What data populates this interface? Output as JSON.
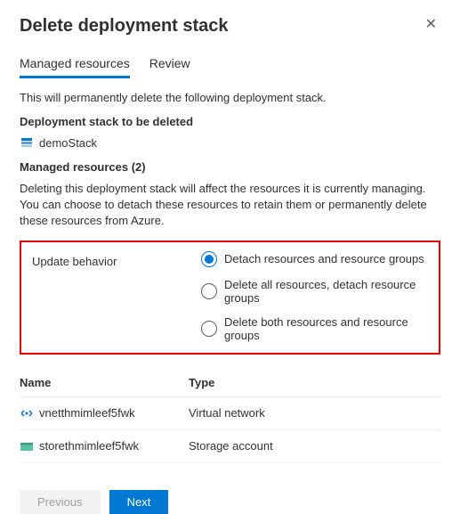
{
  "title": "Delete deployment stack",
  "tabs": {
    "managed": "Managed resources",
    "review": "Review"
  },
  "intro": "This will permanently delete the following deployment stack.",
  "stack_heading": "Deployment stack to be deleted",
  "stack_name": "demoStack",
  "managed_heading": "Managed resources (2)",
  "managed_warning": "Deleting this deployment stack will affect the resources it is currently managing. You can choose to detach these resources to retain them or permanently delete these resources from Azure.",
  "behavior": {
    "label": "Update behavior",
    "options": [
      {
        "label": "Detach resources and resource groups",
        "selected": true
      },
      {
        "label": "Delete all resources, detach resource groups",
        "selected": false
      },
      {
        "label": "Delete both resources and resource groups",
        "selected": false
      }
    ]
  },
  "columns": {
    "name": "Name",
    "type": "Type"
  },
  "resources": [
    {
      "name": "vnetthmimleef5fwk",
      "type": "Virtual network",
      "icon": "vnet"
    },
    {
      "name": "storethmimleef5fwk",
      "type": "Storage account",
      "icon": "storage"
    }
  ],
  "buttons": {
    "previous": "Previous",
    "next": "Next"
  }
}
